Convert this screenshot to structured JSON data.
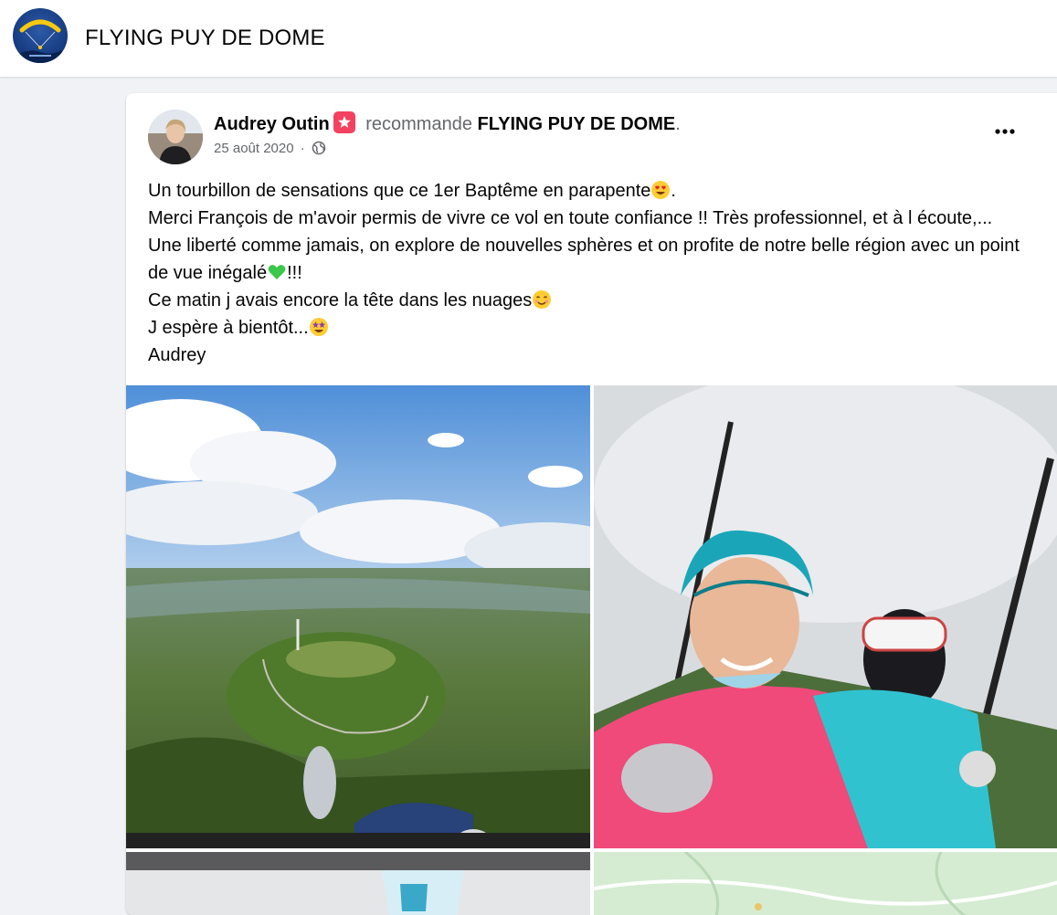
{
  "page": {
    "title": "FLYING PUY DE DOME",
    "logo_icon": "paraglider-logo-icon"
  },
  "post": {
    "author": "Audrey Outin",
    "recommend_icon": "recommendation-badge-icon",
    "verb": "recommande",
    "target_page": "FLYING PUY DE DOME",
    "end_punct": ".",
    "date": "25 août 2020",
    "separator": "·",
    "privacy_icon": "globe-icon",
    "more_label": "•••",
    "text_lines": [
      {
        "text": "Un tourbillon de sensations que ce 1er Baptême en parapente",
        "emoji": "heart-eyes-emoji",
        "after": "."
      },
      {
        "text": "Merci François de m'avoir permis de vivre ce vol en toute confiance !! Très professionnel, et à l écoute,... Une liberté comme jamais, on explore de nouvelles sphères et on profite de notre belle région avec un point de vue inégalé",
        "emoji": "green-heart-emoji",
        "after": "!!!"
      },
      {
        "text": "Ce matin j avais encore la tête dans les nuages",
        "emoji": "smiling-emoji",
        "after": ""
      },
      {
        "text": "J espère à bientôt...",
        "emoji": "star-struck-emoji",
        "after": ""
      },
      {
        "text": "Audrey",
        "emoji": "",
        "after": ""
      }
    ],
    "photos": [
      {
        "icon": "aerial-volcano-photo"
      },
      {
        "icon": "tandem-selfie-photo"
      },
      {
        "icon": "sign-photo"
      },
      {
        "icon": "map-photo"
      }
    ]
  },
  "colors": {
    "background": "#f0f2f5",
    "card": "#ffffff",
    "muted_text": "#65676b",
    "recommend_red": "#f3425f"
  }
}
